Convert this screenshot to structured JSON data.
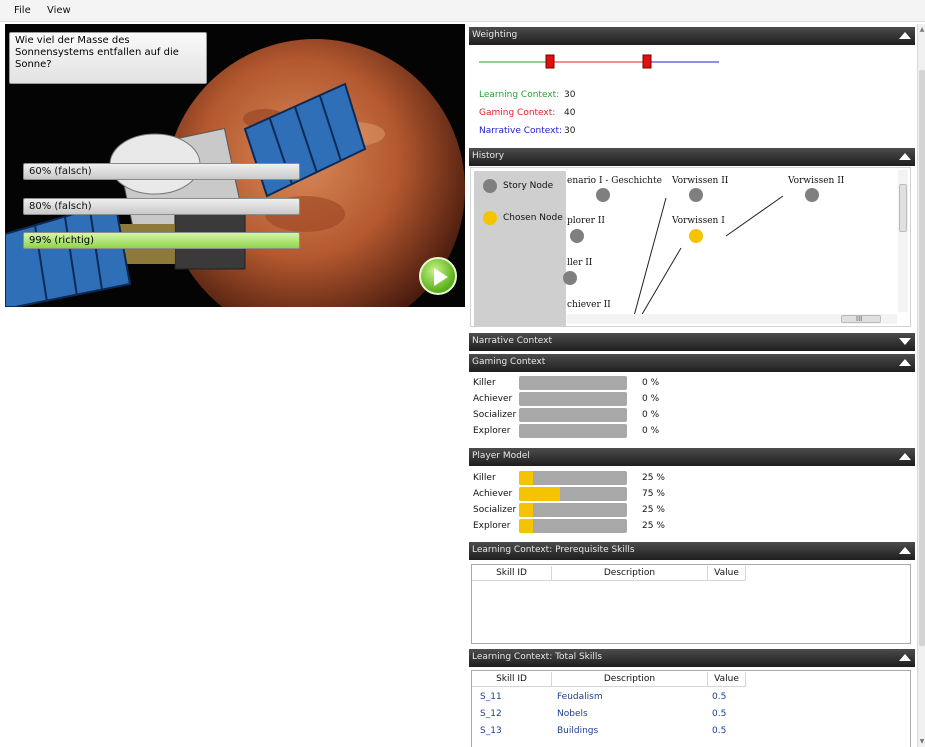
{
  "menu": {
    "file": "File",
    "view": "View"
  },
  "quiz": {
    "question": "Wie viel der Masse des Sonnensystems entfallen auf die Sonne?",
    "answers": [
      {
        "label": "60% (falsch)",
        "state": "wrong"
      },
      {
        "label": "80% (falsch)",
        "state": "wrong"
      },
      {
        "label": "99% (richtig)",
        "state": "correct"
      }
    ]
  },
  "weighting": {
    "title": "Weighting",
    "learning_label": "Learning Context:",
    "learning_value": "30",
    "gaming_label": "Gaming Context:",
    "gaming_value": "40",
    "narrative_label": "Narrative Context:",
    "narrative_value": "30",
    "colors": {
      "learning": "#2e9e2e",
      "gaming": "#e02020",
      "narrative": "#2020d0"
    }
  },
  "history": {
    "title": "History",
    "legend_story": "Story Node",
    "legend_chosen": "Chosen Node",
    "nodes": [
      {
        "label": "enario I - Geschichte",
        "chosen": false
      },
      {
        "label": "Vorwissen II",
        "chosen": false
      },
      {
        "label": "Vorwissen II",
        "chosen": false
      },
      {
        "label": "plorer II",
        "chosen": false
      },
      {
        "label": "Vorwissen I",
        "chosen": true
      },
      {
        "label": "ller II",
        "chosen": false
      },
      {
        "label": "chiever II",
        "chosen": false
      }
    ],
    "scroll_grip": "III"
  },
  "narrative": {
    "title": "Narrative Context"
  },
  "gaming": {
    "title": "Gaming Context",
    "rows": [
      {
        "label": "Killer",
        "value": "0 %",
        "level": 0
      },
      {
        "label": "Achiever",
        "value": "0 %",
        "level": 0
      },
      {
        "label": "Socializer",
        "value": "0 %",
        "level": 0
      },
      {
        "label": "Explorer",
        "value": "0 %",
        "level": 0
      }
    ]
  },
  "player": {
    "title": "Player Model",
    "rows": [
      {
        "label": "Killer",
        "value": "25 %",
        "level": 0.13
      },
      {
        "label": "Achiever",
        "value": "75 %",
        "level": 0.38
      },
      {
        "label": "Socializer",
        "value": "25 %",
        "level": 0.13
      },
      {
        "label": "Explorer",
        "value": "25 %",
        "level": 0.13
      }
    ]
  },
  "prereq": {
    "title": "Learning Context: Prerequisite Skills",
    "columns": [
      "Skill ID",
      "Description",
      "Value"
    ]
  },
  "total": {
    "title": "Learning Context: Total Skills",
    "columns": [
      "Skill ID",
      "Description",
      "Value"
    ],
    "rows": [
      {
        "id": "S_11",
        "desc": "Feudalism",
        "value": "0.5"
      },
      {
        "id": "S_12",
        "desc": "Nobels",
        "value": "0.5"
      },
      {
        "id": "S_13",
        "desc": "Buildings",
        "value": "0.5"
      }
    ]
  }
}
